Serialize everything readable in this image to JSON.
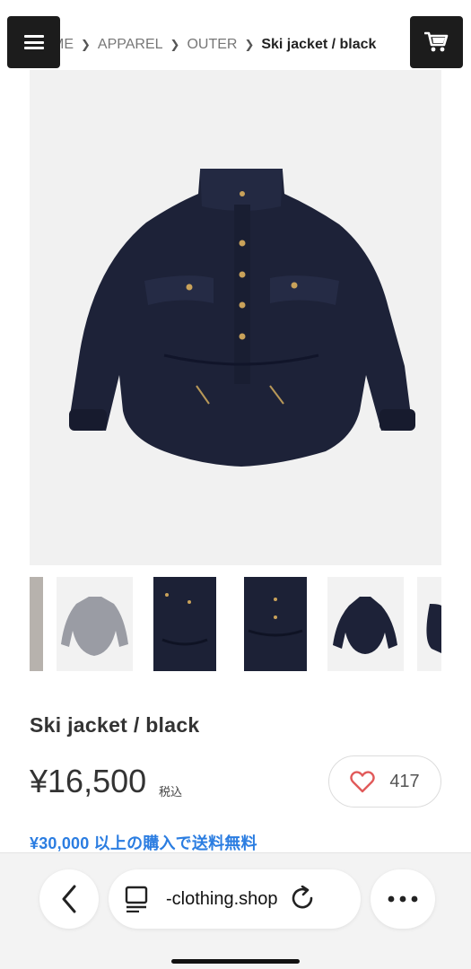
{
  "header": {
    "menu_icon": "hamburger-menu-icon",
    "cart_icon": "shopping-cart-icon"
  },
  "breadcrumb": {
    "items": [
      "ME",
      "APPAREL",
      "OUTER",
      "Ski jacket / black"
    ]
  },
  "product": {
    "title": "Ski jacket / black",
    "price": "¥16,500",
    "tax_label": "税込",
    "favorite_count": "417",
    "shipping_note": "¥30,000 以上の購入で送料無料"
  },
  "browser": {
    "url": "-clothing.shop",
    "back_icon": "chevron-left-icon",
    "tabs_icon": "tabs-icon",
    "reload_icon": "reload-icon",
    "more_icon": "more-dots-icon"
  },
  "colors": {
    "button_bg": "#1c1c1c",
    "shipping_link": "#2b7de1",
    "heart": "#e15a5a",
    "jacket_navy": "#1d2238"
  }
}
